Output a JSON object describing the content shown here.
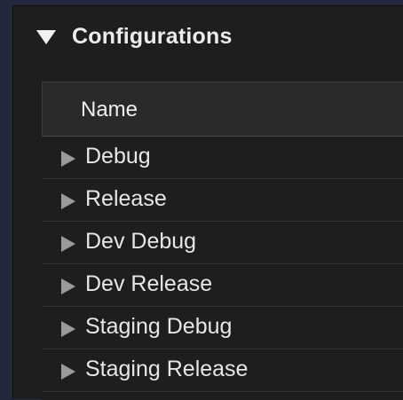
{
  "section": {
    "title": "Configurations",
    "expanded": true
  },
  "table": {
    "column_header": "Name",
    "rows": [
      {
        "label": "Debug"
      },
      {
        "label": "Release"
      },
      {
        "label": "Dev Debug"
      },
      {
        "label": "Dev Release"
      },
      {
        "label": "Staging Debug"
      },
      {
        "label": "Staging Release"
      }
    ]
  },
  "icons": {
    "section_toggle": "disclosure-triangle-down-icon",
    "row_toggle": "disclosure-triangle-right-icon"
  },
  "colors": {
    "background": "#23273a",
    "panel": "#1e1e1e",
    "header": "#2a2a2a",
    "text": "#e6e6e6",
    "triangle": "#9a9a9a"
  }
}
